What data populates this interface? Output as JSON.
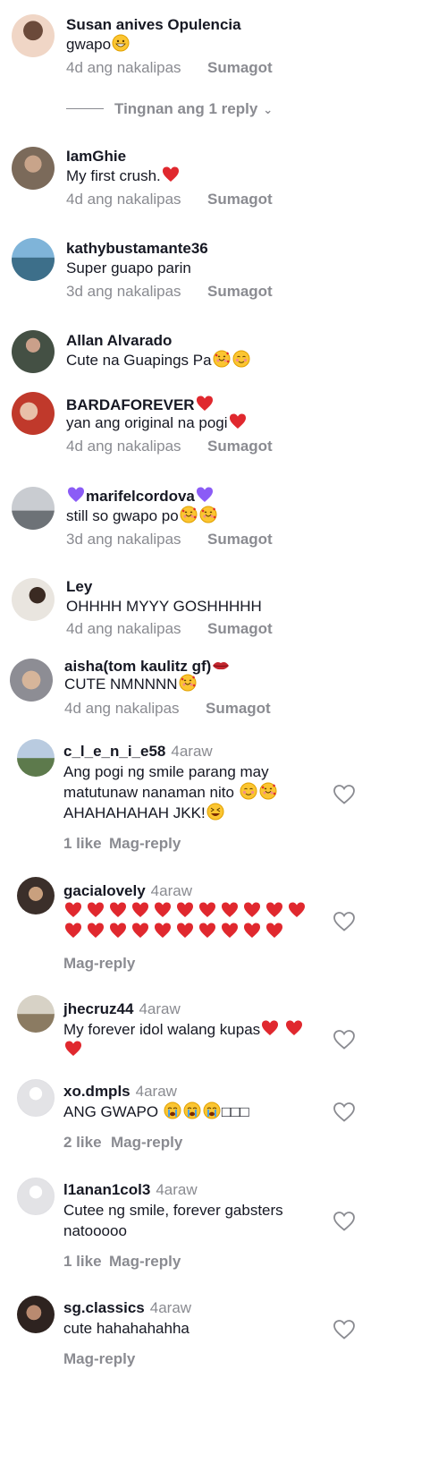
{
  "comments_top": [
    {
      "user": "Susan anives Opulencia",
      "text": "gwapo",
      "time": "4d ang nakalipas",
      "reply": "Sumagot"
    },
    {
      "user": "IamGhie",
      "text": "My first crush.",
      "time": "4d ang nakalipas",
      "reply": "Sumagot"
    },
    {
      "user": "kathybustamante36",
      "text": "Super guapo parin",
      "time": "3d ang nakalipas",
      "reply": "Sumagot"
    },
    {
      "user": "Allan Alvarado",
      "text": "Cute na Guapings Pa",
      "time": "",
      "reply": ""
    },
    {
      "user": "BARDAFOREVER",
      "text": "yan ang original na pogi",
      "time": "4d ang nakalipas",
      "reply": "Sumagot"
    },
    {
      "user": "marifelcordova",
      "text": "still so gwapo po",
      "time": "3d ang nakalipas",
      "reply": "Sumagot"
    },
    {
      "user": "Ley",
      "text": "OHHHH MYYY GOSHHHHH",
      "time": "4d ang nakalipas",
      "reply": "Sumagot"
    },
    {
      "user": "aisha(tom kaulitz gf)",
      "text": "CUTE NMNNNN",
      "time": "4d ang nakalipas",
      "reply": "Sumagot"
    }
  ],
  "view_replies": "Tingnan ang 1 reply",
  "comments_bottom": [
    {
      "user": "c_l_e_n_i_e58",
      "time": "4araw",
      "line1": "Ang pogi ng smile parang may",
      "line2": "matutunaw nanaman nito",
      "line3": "AHAHAHAHAH JKK!",
      "likes": "1 like",
      "reply": "Mag-reply"
    },
    {
      "user": "gacialovely",
      "time": "4araw",
      "likes": "",
      "reply": "Mag-reply"
    },
    {
      "user": "jhecruz44",
      "time": "4araw",
      "line1": "My forever idol walang kupas",
      "likes": "",
      "reply": ""
    },
    {
      "user": "xo.dmpls",
      "time": "4araw",
      "line1": "ANG GWAPO",
      "tail": "□□□",
      "likes": "2 like",
      "reply": "Mag-reply"
    },
    {
      "user": "l1anan1col3",
      "time": "4araw",
      "line1": "Cutee ng smile, forever gabsters",
      "line2": "natooooo",
      "likes": "1 like",
      "reply": "Mag-reply"
    },
    {
      "user": "sg.classics",
      "time": "4araw",
      "line1": "cute hahahahahha",
      "likes": "",
      "reply": "Mag-reply"
    }
  ],
  "icons": {
    "like": "heart-outline-icon",
    "chevron": "chevron-down-icon"
  },
  "colors": {
    "text": "#161823",
    "muted": "#8a8b91",
    "heart": "#e0282e",
    "purple_heart": "#8b5cf6"
  }
}
